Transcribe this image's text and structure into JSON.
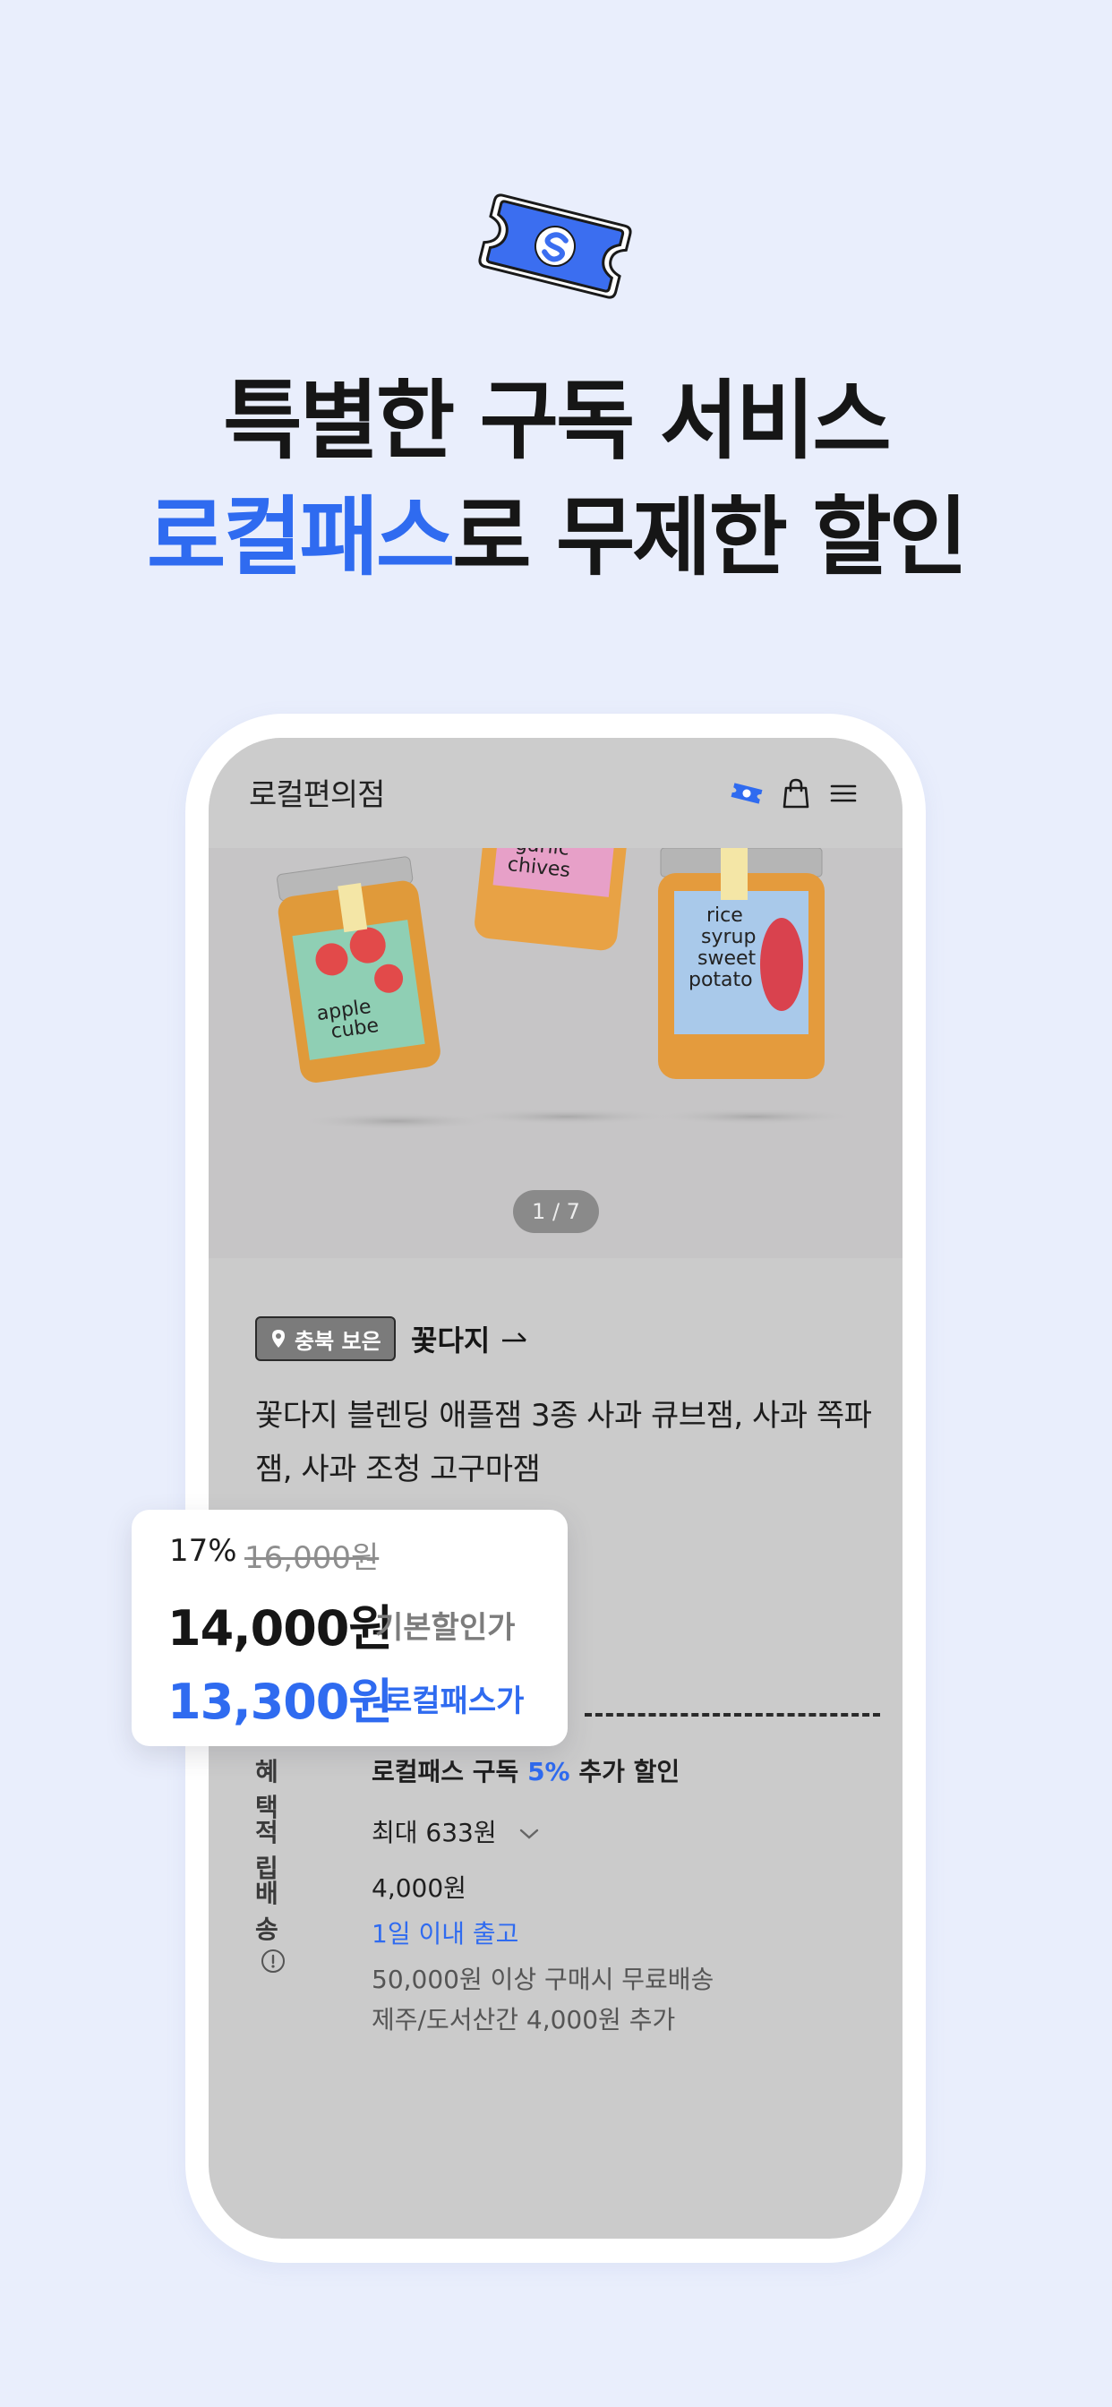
{
  "hero": {
    "line1": "특별한 구독 서비스",
    "line2_accent": "로컬패스",
    "line2_rest": "로 무제한 할인"
  },
  "app": {
    "logo": "로컬편의점",
    "header_icons": [
      "ticket-icon",
      "shopping-bag-icon",
      "menu-icon"
    ]
  },
  "gallery": {
    "pager": "1 / 7",
    "jar_labels": [
      {
        "line1": "apple",
        "line2": "cube"
      },
      {
        "line1": "garlic",
        "line2": "chives"
      },
      {
        "line1": "rice",
        "line2": "syrup",
        "line3": "sweet",
        "line4": "potato"
      }
    ]
  },
  "product": {
    "region": "충북 보은",
    "brand": "꽃다지",
    "title": "꽃다지 블렌딩 애플잼 3종 사과 큐브잼, 사과 쪽파잼, 사과 조청 고구마잼"
  },
  "price_card": {
    "discount": "17%",
    "original": "16,000원",
    "price": "14,000원",
    "price_label": "기본할인가",
    "pass_price": "13,300원",
    "pass_label": "로컬패스가"
  },
  "info": {
    "benefit_label": "혜택",
    "benefit_prefix": "로컬패스 구독",
    "benefit_pct": "5%",
    "benefit_suffix": "추가 할인",
    "points_label": "적립",
    "points_value": "최대 633원",
    "shipping_label": "배송",
    "shipping_fee": "4,000원",
    "shipping_dispatch": "1일 이내 출고",
    "shipping_free": "50,000원 이상 구매시 무료배송",
    "shipping_extra": "제주/도서산간 4,000원 추가"
  },
  "colors": {
    "accent": "#2F6BF0",
    "background": "#E9EEFC",
    "screen": "#CBCBCB"
  }
}
